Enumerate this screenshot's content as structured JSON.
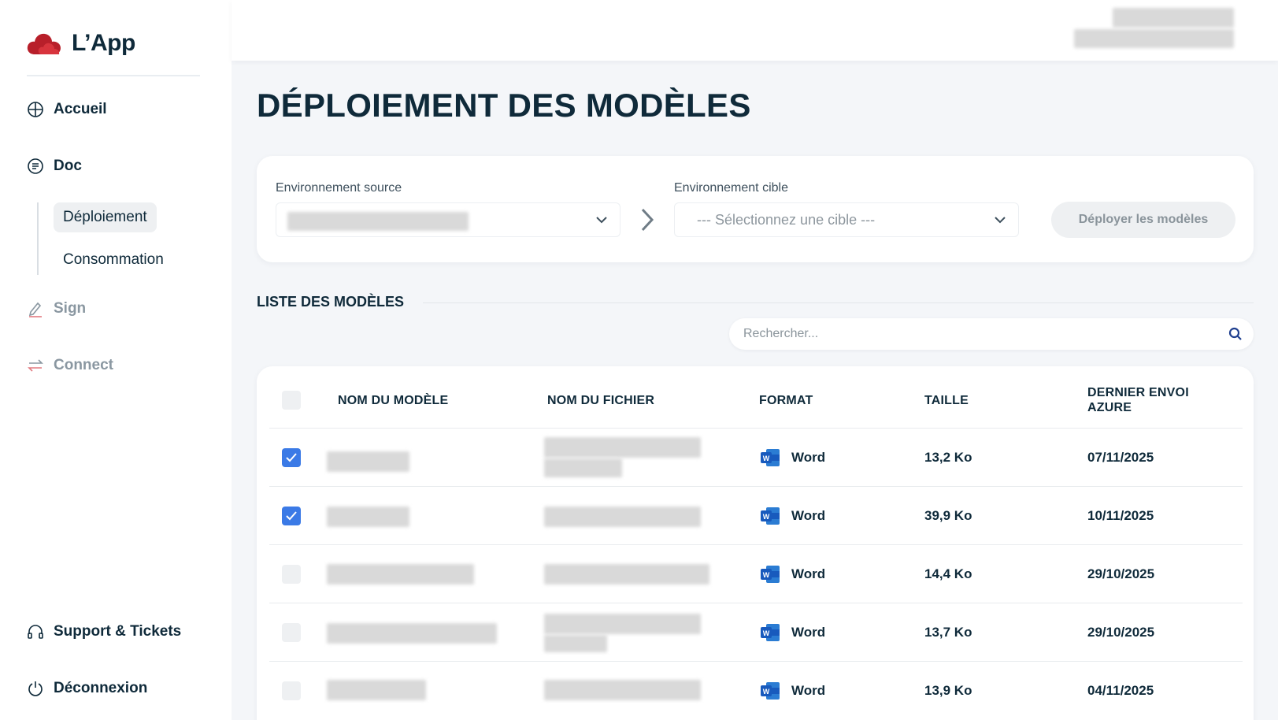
{
  "app": {
    "name": "L’App",
    "brand_color": "#c8262f"
  },
  "nav": {
    "accueil": "Accueil",
    "doc": "Doc",
    "sub_deploiement": "Déploiement",
    "sub_consommation": "Consommation",
    "sign": "Sign",
    "connect": "Connect",
    "support": "Support & Tickets",
    "logout": "Déconnexion"
  },
  "page": {
    "title": "DÉPLOIEMENT DES MODÈLES"
  },
  "deploy": {
    "source_label": "Environnement source",
    "target_label": "Environnement cible",
    "target_placeholder": "--- Sélectionnez une cible ---",
    "button_label": "Déployer les modèles"
  },
  "list": {
    "title": "LISTE DES MODÈLES",
    "search_placeholder": "Rechercher...",
    "columns": [
      "NOM DU MODÈLE",
      "NOM DU FICHIER",
      "FORMAT",
      "TAILLE",
      "DERNIER ENVOI AZURE"
    ],
    "rows": [
      {
        "checked": true,
        "format": "Word",
        "size": "13,2 Ko",
        "date": "07/11/2025"
      },
      {
        "checked": true,
        "format": "Word",
        "size": "39,9 Ko",
        "date": "10/11/2025"
      },
      {
        "checked": false,
        "format": "Word",
        "size": "14,4 Ko",
        "date": "29/10/2025"
      },
      {
        "checked": false,
        "format": "Word",
        "size": "13,7 Ko",
        "date": "29/10/2025"
      },
      {
        "checked": false,
        "format": "Word",
        "size": "13,9 Ko",
        "date": "04/11/2025"
      }
    ]
  },
  "icons": {
    "accueil": "globe-icon",
    "doc": "document-icon",
    "sign": "pen-icon",
    "connect": "swap-arrows-icon",
    "support": "headset-icon",
    "logout": "power-icon",
    "search": "search-icon",
    "format": "word-icon"
  },
  "colors": {
    "accent": "#3b7ae6",
    "text": "#0f2a3a",
    "muted": "#8a97a1",
    "word_blue": "#185abd"
  }
}
